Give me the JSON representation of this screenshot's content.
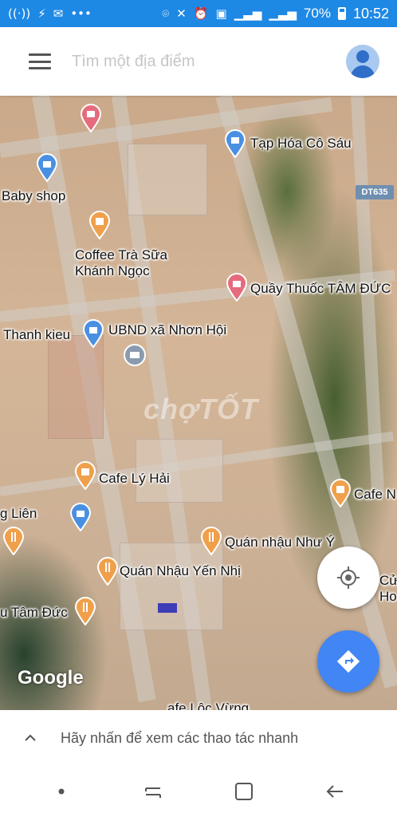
{
  "status_bar": {
    "battery": "70%",
    "time": "10:52"
  },
  "search": {
    "placeholder": "Tìm một địa điểm"
  },
  "map": {
    "route_badge": "DT635",
    "watermark": "chợTỐT",
    "attribution": "Google",
    "places": [
      {
        "label": "Tạp Hóa Cô Sáu",
        "icon": "shopping-bag-icon",
        "color": "#4a90e2"
      },
      {
        "label": "Baby shop",
        "icon": "shopping-bag-icon",
        "color": "#4a90e2"
      },
      {
        "label": "Coffee Trà Sữa\nKhánh Ngọc",
        "icon": "cup-icon",
        "color": "#f0a04b"
      },
      {
        "label": "Quầy Thuốc TÂM ĐỨC",
        "icon": "shopping-bag-icon",
        "color": "#e56b7d"
      },
      {
        "label": "Thanh kieu",
        "icon": "shopping-bag-icon",
        "color": "#4a90e2"
      },
      {
        "label": "UBND xã Nhơn Hội",
        "icon": "government-building-icon",
        "color": "#8a9bb0"
      },
      {
        "label": "Cafe Lý Hải",
        "icon": "cup-icon",
        "color": "#f0a04b"
      },
      {
        "label": "Cafe N",
        "icon": "cup-icon",
        "color": "#f0a04b"
      },
      {
        "label": "g Liên",
        "icon": "restaurant-icon",
        "color": "#f0a04b"
      },
      {
        "label": "Quán nhậu Như Ý",
        "icon": "restaurant-icon",
        "color": "#f0a04b"
      },
      {
        "label": "Quán Nhậu Yến Nhị",
        "icon": "restaurant-icon",
        "color": "#f0a04b"
      },
      {
        "label": "u Tâm Đức",
        "icon": "restaurant-icon",
        "color": "#f0a04b"
      },
      {
        "label": "Cử\nHo",
        "icon": "",
        "color": ""
      },
      {
        "label": "afe Lộc Vừng",
        "icon": "",
        "color": ""
      }
    ]
  },
  "bottom_sheet": {
    "text": "Hãy nhấn để xem các thao tác nhanh"
  },
  "colors": {
    "status_bar": "#1e88e5",
    "accent_blue": "#4285f4",
    "cafe_pin": "#f0a04b",
    "shop_pin": "#4a90e2",
    "pharmacy_pin": "#e56b7d"
  }
}
